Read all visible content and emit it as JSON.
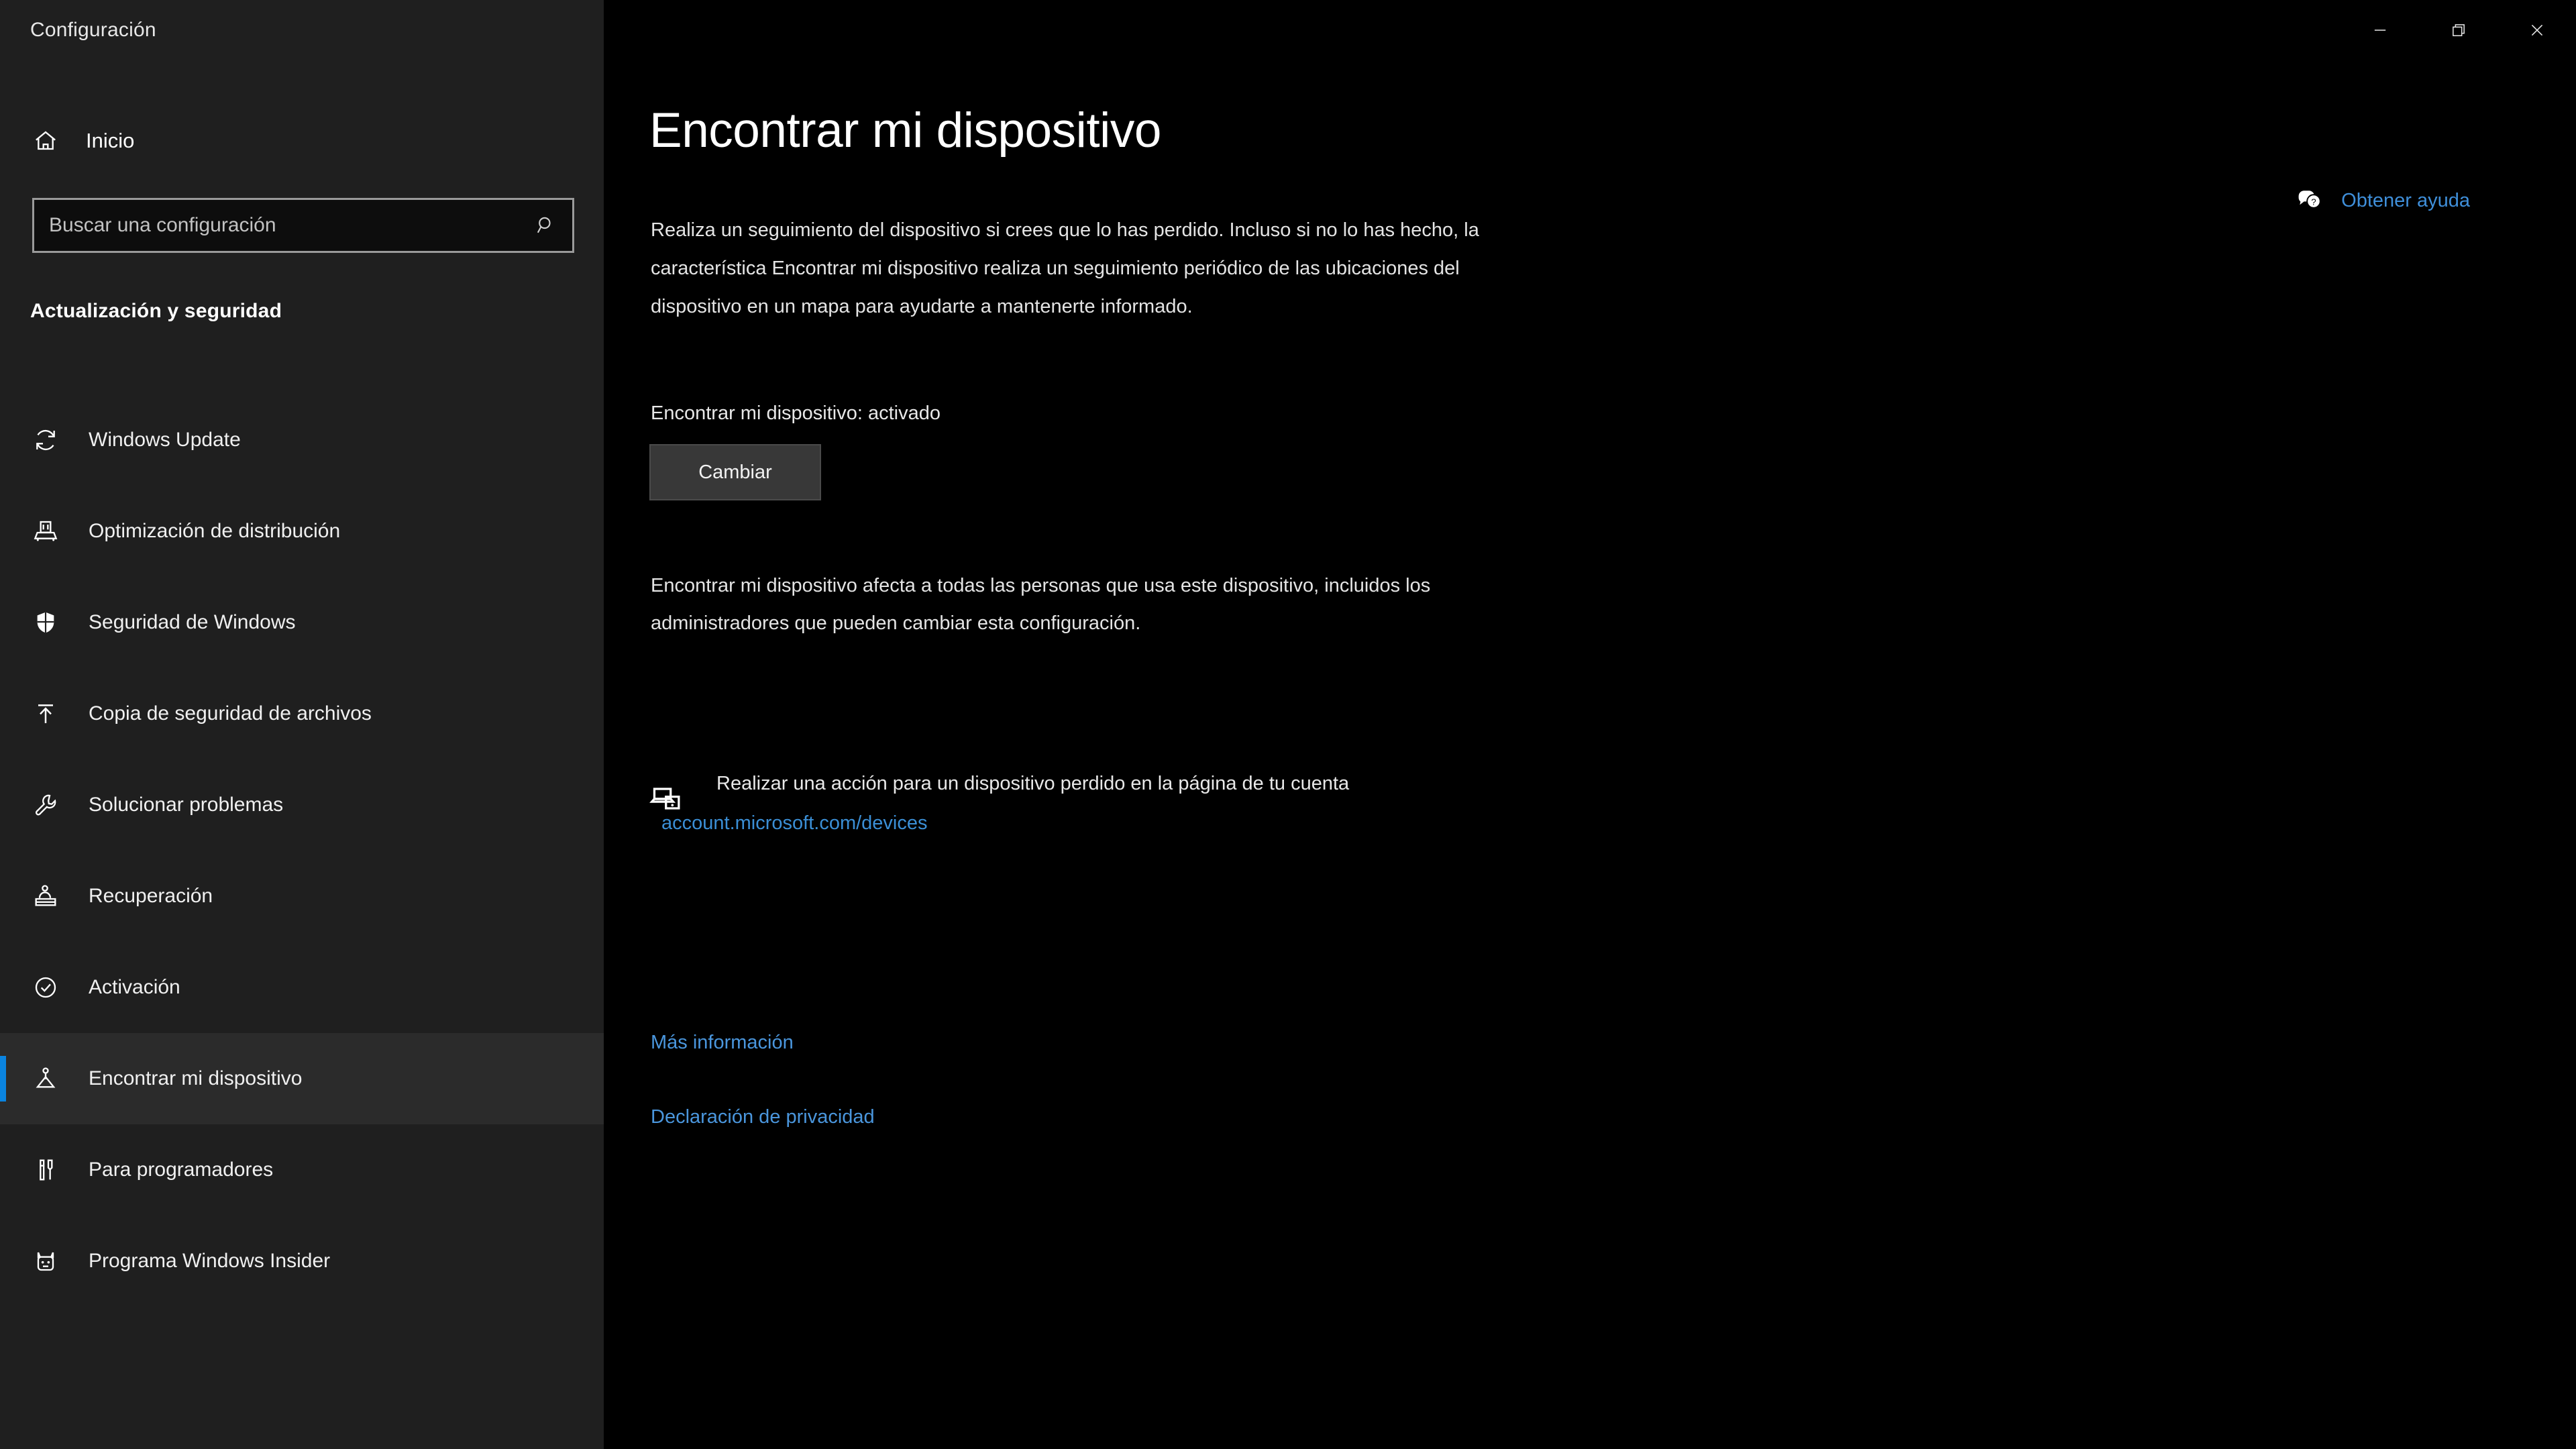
{
  "window": {
    "app_title": "Configuración",
    "controls": {
      "minimize": "minimize-icon",
      "restore": "restore-icon",
      "close": "close-icon"
    }
  },
  "sidebar": {
    "home": {
      "label": "Inicio",
      "icon": "home-icon"
    },
    "search": {
      "placeholder": "Buscar una configuración",
      "value": "",
      "icon": "search-icon"
    },
    "section_title": "Actualización y seguridad",
    "items": [
      {
        "label": "Windows Update",
        "icon": "sync-icon",
        "active": false
      },
      {
        "label": "Optimización de distribución",
        "icon": "delivery-optimization-icon",
        "active": false
      },
      {
        "label": "Seguridad de Windows",
        "icon": "shield-icon",
        "active": false
      },
      {
        "label": "Copia de seguridad de archivos",
        "icon": "backup-upload-icon",
        "active": false
      },
      {
        "label": "Solucionar problemas",
        "icon": "wrench-icon",
        "active": false
      },
      {
        "label": "Recuperación",
        "icon": "recovery-icon",
        "active": false
      },
      {
        "label": "Activación",
        "icon": "check-circle-icon",
        "active": false
      },
      {
        "label": "Encontrar mi dispositivo",
        "icon": "find-device-icon",
        "active": true
      },
      {
        "label": "Para programadores",
        "icon": "developer-tools-icon",
        "active": false
      },
      {
        "label": "Programa Windows Insider",
        "icon": "insider-cat-icon",
        "active": false
      }
    ]
  },
  "main": {
    "page_title": "Encontrar mi dispositivo",
    "description": "Realiza un seguimiento del dispositivo si crees que lo has perdido. Incluso si no lo has hecho, la característica Encontrar mi dispositivo realiza un seguimiento periódico de las ubicaciones del dispositivo en un mapa para ayudarte a mantenerte informado.",
    "status_line": "Encontrar mi dispositivo: activado",
    "change_button": "Cambiar",
    "note": "Encontrar mi dispositivo afecta a todas las personas que usa este dispositivo, incluidos los administradores que pueden cambiar esta configuración.",
    "devices": {
      "icon": "devices-icon",
      "text": "Realizar una acción para un dispositivo perdido en la página de tu cuenta",
      "link": "account.microsoft.com/devices"
    },
    "footer_links": [
      "Más información",
      "Declaración de privacidad"
    ],
    "help": {
      "label": "Obtener ayuda",
      "icon": "help-chat-icon"
    }
  },
  "colors": {
    "accent": "#0a84e0",
    "link": "#4a96dd",
    "sidebar_bg": "#1f1f1f",
    "main_bg": "#000000"
  }
}
